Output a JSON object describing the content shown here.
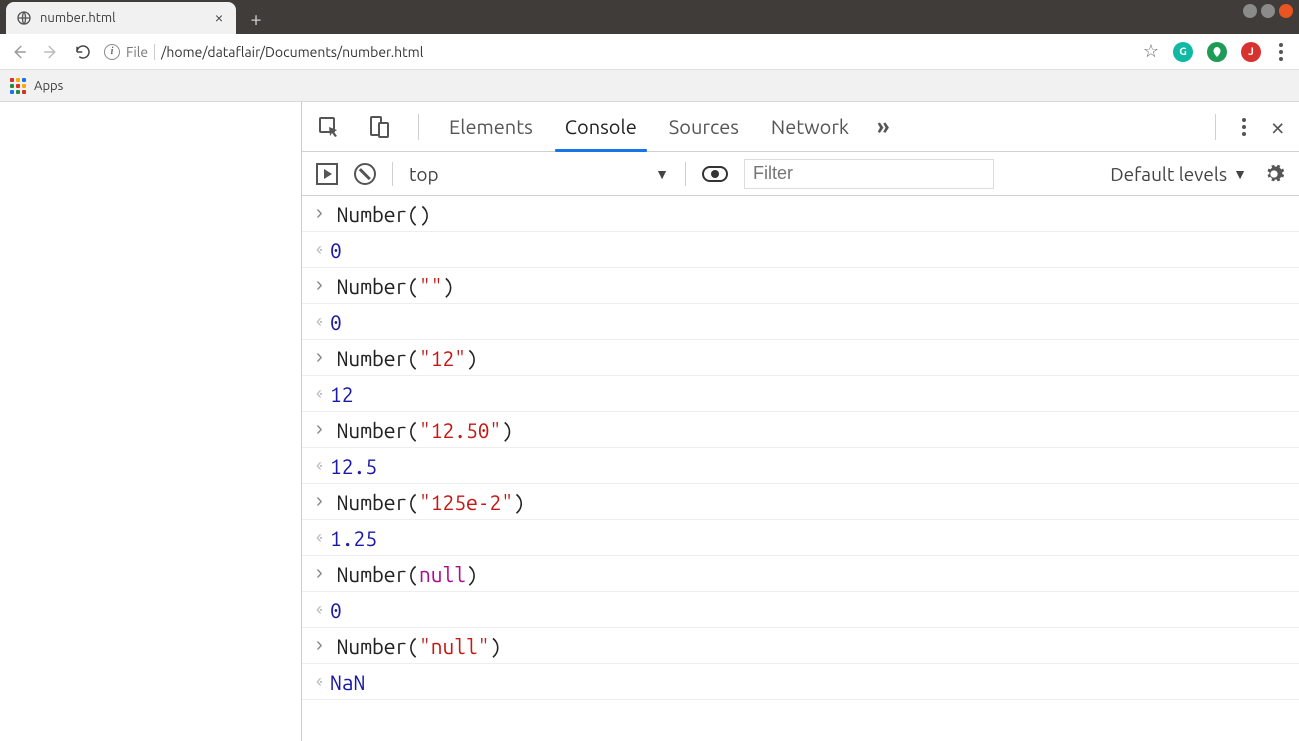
{
  "window": {
    "tab_title": "number.html"
  },
  "address": {
    "scheme": "File",
    "path": "/home/dataflair/Documents/number.html"
  },
  "bookmarks": {
    "apps_label": "Apps"
  },
  "ext": {
    "g_label": "G",
    "j_label": "J"
  },
  "devtools": {
    "tabs": {
      "elements": "Elements",
      "console": "Console",
      "sources": "Sources",
      "network": "Network"
    },
    "more_glyph": "»"
  },
  "console_toolbar": {
    "context": "top",
    "filter_placeholder": "Filter",
    "levels_label": "Default levels"
  },
  "console_rows": [
    {
      "type": "in",
      "parts": [
        {
          "t": "fn",
          "v": "Number"
        },
        {
          "t": "fn",
          "v": "()"
        }
      ]
    },
    {
      "type": "out",
      "parts": [
        {
          "t": "num",
          "v": "0"
        }
      ]
    },
    {
      "type": "in",
      "parts": [
        {
          "t": "fn",
          "v": "Number("
        },
        {
          "t": "str",
          "v": "\"\""
        },
        {
          "t": "fn",
          "v": ")"
        }
      ]
    },
    {
      "type": "out",
      "parts": [
        {
          "t": "num",
          "v": "0"
        }
      ]
    },
    {
      "type": "in",
      "parts": [
        {
          "t": "fn",
          "v": "Number("
        },
        {
          "t": "str",
          "v": "\"12\""
        },
        {
          "t": "fn",
          "v": ")"
        }
      ]
    },
    {
      "type": "out",
      "parts": [
        {
          "t": "num",
          "v": "12"
        }
      ]
    },
    {
      "type": "in",
      "parts": [
        {
          "t": "fn",
          "v": "Number("
        },
        {
          "t": "str",
          "v": "\"12.50\""
        },
        {
          "t": "fn",
          "v": ")"
        }
      ]
    },
    {
      "type": "out",
      "parts": [
        {
          "t": "num",
          "v": "12.5"
        }
      ]
    },
    {
      "type": "in",
      "parts": [
        {
          "t": "fn",
          "v": "Number("
        },
        {
          "t": "str",
          "v": "\"125e-2\""
        },
        {
          "t": "fn",
          "v": ")"
        }
      ]
    },
    {
      "type": "out",
      "parts": [
        {
          "t": "num",
          "v": "1.25"
        }
      ]
    },
    {
      "type": "in",
      "parts": [
        {
          "t": "fn",
          "v": "Number("
        },
        {
          "t": "key",
          "v": "null"
        },
        {
          "t": "fn",
          "v": ")"
        }
      ]
    },
    {
      "type": "out",
      "parts": [
        {
          "t": "num",
          "v": "0"
        }
      ]
    },
    {
      "type": "in",
      "parts": [
        {
          "t": "fn",
          "v": "Number("
        },
        {
          "t": "str",
          "v": "\"null\""
        },
        {
          "t": "fn",
          "v": ")"
        }
      ]
    },
    {
      "type": "out",
      "parts": [
        {
          "t": "num",
          "v": "NaN"
        }
      ]
    }
  ]
}
